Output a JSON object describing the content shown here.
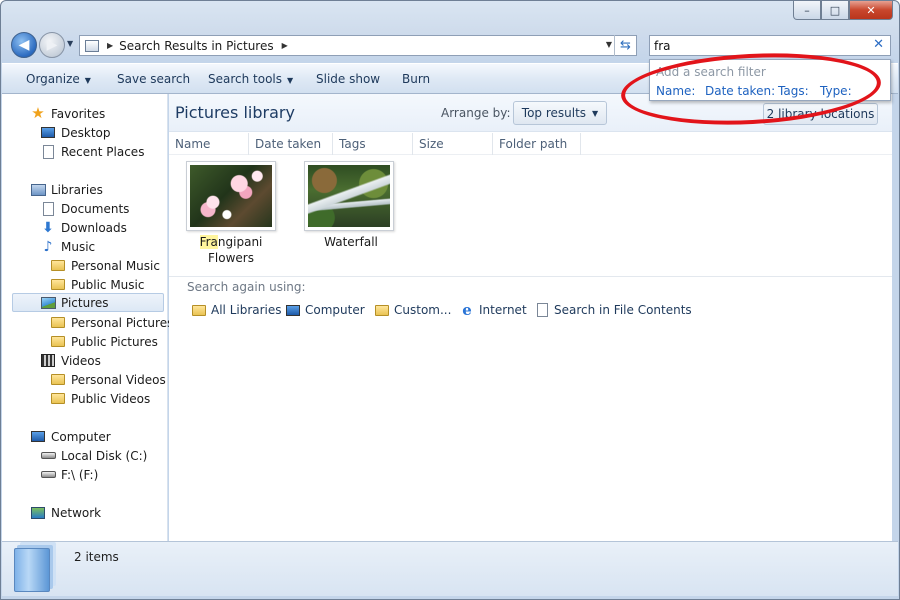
{
  "window": {
    "caption_min": "–",
    "caption_max": "□",
    "caption_close": "✕"
  },
  "address": {
    "path": "Search Results in Pictures",
    "back_icon": "back-arrow-icon",
    "forward_icon": "forward-arrow-icon"
  },
  "search": {
    "value": "fra",
    "clear_glyph": "✕"
  },
  "toolbar": {
    "organize": "Organize",
    "save_search": "Save search",
    "search_tools": "Search tools",
    "slide_show": "Slide show",
    "burn": "Burn"
  },
  "filter_popup": {
    "hint": "Add a search filter",
    "filters": [
      "Name:",
      "Date taken:",
      "Tags:",
      "Type:"
    ]
  },
  "nav": {
    "favorites": "Favorites",
    "desktop": "Desktop",
    "recent_places": "Recent Places",
    "libraries": "Libraries",
    "documents": "Documents",
    "downloads": "Downloads",
    "music": "Music",
    "personal_music": "Personal Music",
    "public_music": "Public Music",
    "pictures": "Pictures",
    "personal_pictures": "Personal Pictures",
    "public_pictures": "Public Pictures",
    "videos": "Videos",
    "personal_videos": "Personal Videos",
    "public_videos": "Public Videos",
    "computer": "Computer",
    "local_disk": "Local Disk (C:)",
    "f_drive": "F:\\ (F:)",
    "network": "Network"
  },
  "content": {
    "library_title": "Pictures library",
    "arrange_label": "Arrange by:",
    "arrange_value": "Top results",
    "locations": "2 library locations",
    "columns": [
      "Name",
      "Date taken",
      "Tags",
      "Size",
      "Folder path"
    ],
    "items": [
      {
        "highlight": "Fra",
        "rest": "ngipani",
        "line2": "Flowers"
      },
      {
        "label": "Waterfall"
      }
    ],
    "search_again_label": "Search again using:",
    "search_again": [
      "All Libraries",
      "Computer",
      "Custom...",
      "Internet",
      "Search in File Contents"
    ]
  },
  "details": {
    "count": "2 items"
  },
  "colors": {
    "accent": "#1e62c0",
    "annotation_ring": "#e2141a",
    "highlight": "#fff59d"
  }
}
